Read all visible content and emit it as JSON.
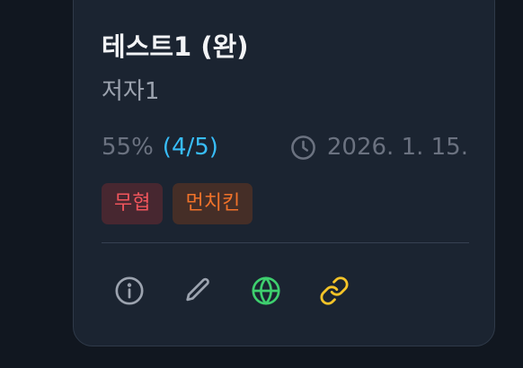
{
  "card": {
    "title": "테스트1 (완)",
    "author": "저자1",
    "progress_percent": "55%",
    "progress_count": "(4/5)",
    "date": "2026. 1. 15.",
    "tags": [
      "무협",
      "먼치킨"
    ]
  },
  "icons": {
    "clock": "clock-icon",
    "info": "info-icon",
    "edit": "pencil-icon",
    "web": "globe-icon",
    "link": "link-icon"
  },
  "colors": {
    "background": "#111720",
    "card": "#1b2431",
    "title": "#f3f4f6",
    "muted": "#6b7280",
    "accent_blue": "#38bdf8",
    "tag_red_bg": "#472730",
    "tag_red_text": "#f0555c",
    "tag_orange_bg": "#452e27",
    "tag_orange_text": "#f0722a",
    "globe_green": "#3ecf6e",
    "link_yellow": "#f5c428"
  }
}
